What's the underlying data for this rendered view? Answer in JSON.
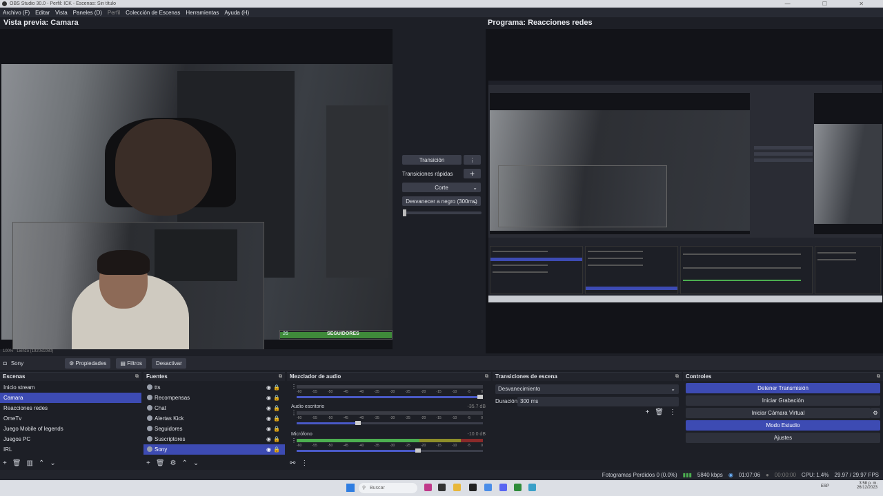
{
  "window": {
    "title": "OBS Studio 30.0 - Perfil: ICK - Escenas: Sin título",
    "controls": "— ☐ ✕"
  },
  "menu": [
    "Archivo (F)",
    "Editar",
    "Vista",
    "Paneles (D)",
    "Perfil",
    "Colección de Escenas",
    "Herramientas",
    "Ayuda (H)"
  ],
  "preview": {
    "title": "Vista previa: Camara",
    "follower_label": "SEGUIDORES",
    "follower_count": "26",
    "zoom": "100%",
    "canvas": "Lienzo (1920x1080)"
  },
  "program": {
    "title": "Programa: Reacciones redes"
  },
  "transition_panel": {
    "transition_btn": "Transición",
    "quick_label": "Transiciones rápidas",
    "cut_btn": "Corte",
    "fade_btn": "Desvanecer a negro (300ms)"
  },
  "context_bar": {
    "source": "Sony",
    "properties": "Propiedades",
    "filters": "Filtros",
    "deactivate": "Desactivar"
  },
  "scenes": {
    "title": "Escenas",
    "items": [
      "Inicio stream",
      "Camara",
      "Reacciones redes",
      "OmeTv",
      "Juego Mobile of legends",
      "Juegos PC",
      "IRL"
    ],
    "selected": "Camara"
  },
  "sources": {
    "title": "Fuentes",
    "items": [
      "tts",
      "Recompensas",
      "Chat",
      "Alertas Kick",
      "Seguidores",
      "Suscriptores",
      "Sony"
    ],
    "selected": "Sony"
  },
  "mixer": {
    "title": "Mezclador de audio",
    "channels": [
      {
        "name": "",
        "db": ""
      },
      {
        "name": "Audio escritorio",
        "db": "-35.7 dB"
      },
      {
        "name": "Micrófono",
        "db": "-10.0 dB"
      }
    ],
    "scale": [
      "-60",
      "-55",
      "-50",
      "-45",
      "-40",
      "-35",
      "-30",
      "-25",
      "-20",
      "-15",
      "-10",
      "-5",
      "0"
    ]
  },
  "scene_transitions": {
    "title": "Transiciones de escena",
    "selected": "Desvanecimiento",
    "duration_label": "Duración",
    "duration_value": "300 ms"
  },
  "controls": {
    "title": "Controles",
    "buttons": [
      "Detener Transmisión",
      "Iniciar Grabación",
      "Iniciar Cámara Virtual",
      "Modo Estudio",
      "Ajustes"
    ]
  },
  "status": {
    "dropped": "Fotogramas Perdidos 0 (0.0%)",
    "bitrate": "5840 kbps",
    "live_time": "01:07:06",
    "rec_time": "00:00:00",
    "cpu": "CPU: 1.4%",
    "fps": "29.97 / 29.97 FPS"
  },
  "taskbar": {
    "search": "Buscar",
    "lang": "ESP",
    "time": "3:58 p. m.",
    "date": "26/12/2023"
  },
  "colors": {
    "accent": "#3d4bb3",
    "bg": "#1d1f26",
    "meter_green": "#4caf50"
  }
}
